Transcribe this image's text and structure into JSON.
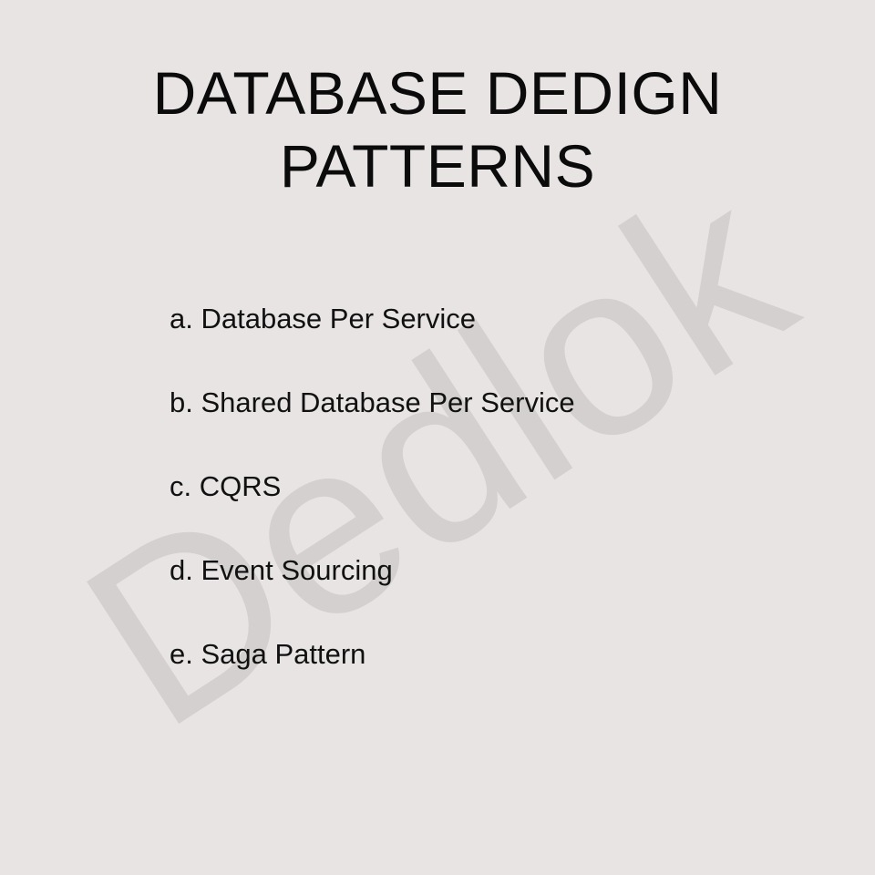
{
  "watermark": "Dedlok",
  "title": {
    "line1": "DATABASE DEDIGN",
    "line2": "PATTERNS"
  },
  "items": [
    "a. Database Per Service",
    "b. Shared Database Per Service",
    "c. CQRS",
    "d. Event Sourcing",
    "e. Saga Pattern"
  ],
  "colors": {
    "background": "#e7e4e3",
    "text": "#0b0b0b",
    "watermark": "#d3d0cf"
  }
}
